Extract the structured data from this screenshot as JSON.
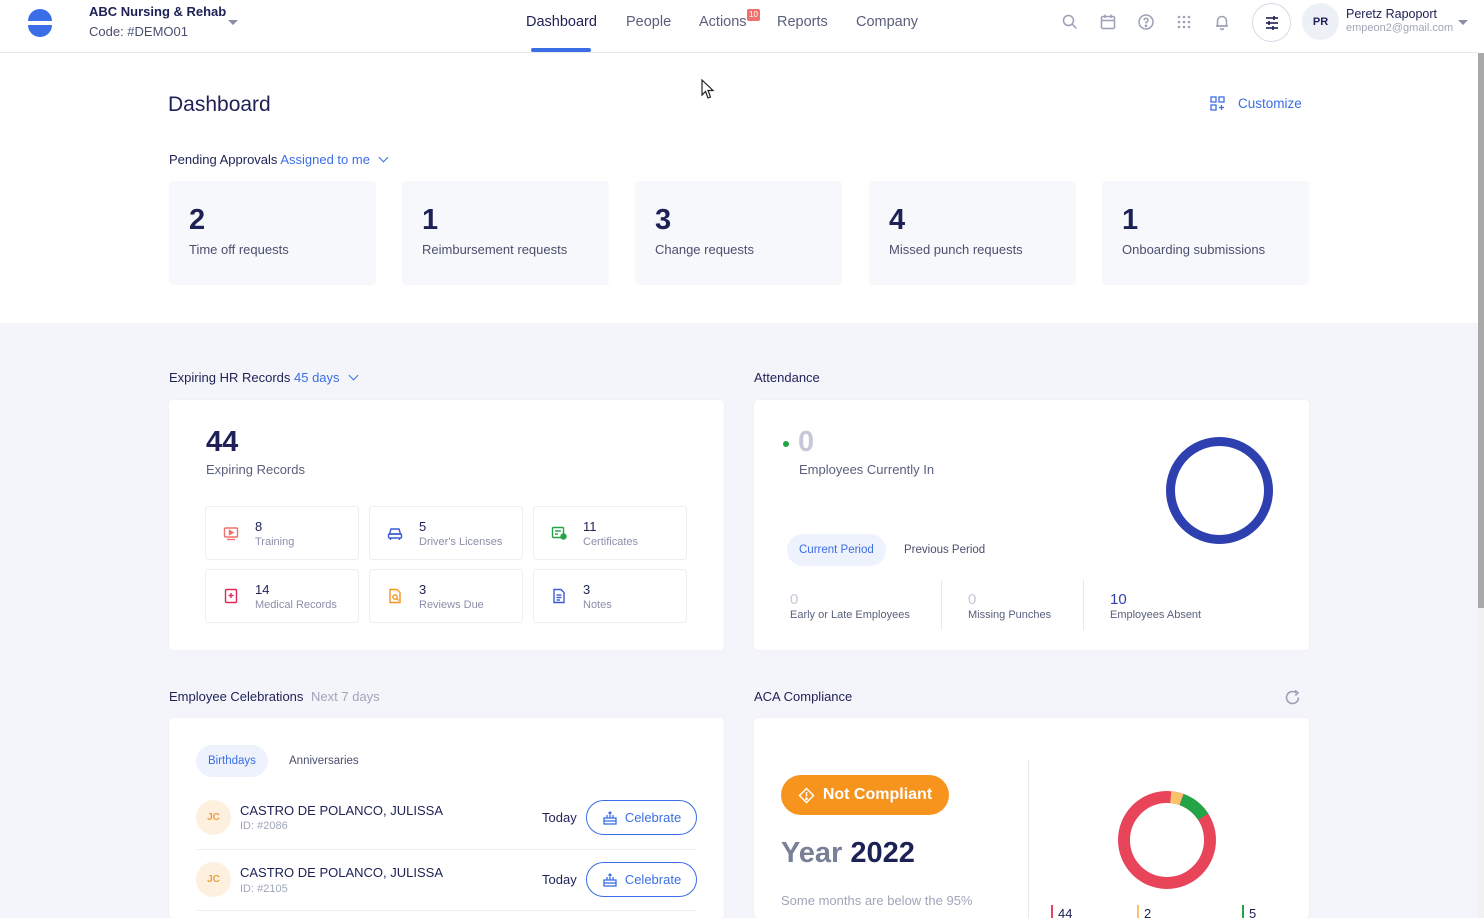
{
  "company": {
    "name": "ABC Nursing & Rehab",
    "code": "Code: #DEMO01"
  },
  "nav": {
    "items": [
      {
        "label": "Dashboard",
        "active": true
      },
      {
        "label": "People"
      },
      {
        "label": "Actions",
        "badge": "10"
      },
      {
        "label": "Reports"
      },
      {
        "label": "Company"
      }
    ]
  },
  "header_icons": [
    "search-icon",
    "calendar-icon",
    "help-icon",
    "apps-grid-icon",
    "bell-icon",
    "filter-sliders-icon"
  ],
  "user": {
    "initials": "PR",
    "name": "Peretz Rapoport",
    "email": "empeon2@gmail.com"
  },
  "page": {
    "title": "Dashboard",
    "customize_label": "Customize"
  },
  "pending_approvals": {
    "label": "Pending Approvals",
    "filter": "Assigned to me",
    "cards": [
      {
        "count": "2",
        "label": "Time off requests"
      },
      {
        "count": "1",
        "label": "Reimbursement requests"
      },
      {
        "count": "3",
        "label": "Change requests"
      },
      {
        "count": "4",
        "label": "Missed punch requests"
      },
      {
        "count": "1",
        "label": "Onboarding submissions"
      }
    ]
  },
  "expiring": {
    "label": "Expiring HR Records",
    "filter": "45 days",
    "total": "44",
    "total_label": "Expiring Records",
    "tiles": [
      {
        "count": "8",
        "label": "Training",
        "icon": "training-icon",
        "color": "#f0706e"
      },
      {
        "count": "5",
        "label": "Driver's Licenses",
        "icon": "car-icon",
        "color": "#3b5bd6"
      },
      {
        "count": "11",
        "label": "Certificates",
        "icon": "certificate-icon",
        "color": "#22a447"
      },
      {
        "count": "14",
        "label": "Medical Records",
        "icon": "medical-icon",
        "color": "#d92a5a"
      },
      {
        "count": "3",
        "label": "Reviews Due",
        "icon": "review-icon",
        "color": "#f7941d"
      },
      {
        "count": "3",
        "label": "Notes",
        "icon": "notes-icon",
        "color": "#3b5bd6"
      }
    ]
  },
  "attendance": {
    "label": "Attendance",
    "currently_in": "0",
    "currently_in_label": "Employees Currently In",
    "periods": [
      "Current Period",
      "Previous Period"
    ],
    "stats": [
      {
        "value": "0",
        "label": "Early or Late Employees"
      },
      {
        "value": "0",
        "label": "Missing Punches"
      },
      {
        "value": "10",
        "label": "Employees Absent"
      }
    ],
    "donut_color": "#2e3fb0"
  },
  "celebrations": {
    "label": "Employee Celebrations",
    "range": "Next 7 days",
    "tabs": [
      "Birthdays",
      "Anniversaries"
    ],
    "people": [
      {
        "initials": "JC",
        "name": "CASTRO DE POLANCO, JULISSA",
        "id": "ID: #2086",
        "when": "Today",
        "action": "Celebrate"
      },
      {
        "initials": "JC",
        "name": "CASTRO DE POLANCO, JULISSA",
        "id": "ID: #2105",
        "when": "Today",
        "action": "Celebrate"
      }
    ]
  },
  "aca": {
    "label": "ACA Compliance",
    "status": "Not Compliant",
    "year_label": "Year",
    "year": "2022",
    "note": "Some months are below the 95%",
    "legend": [
      {
        "value": "44",
        "color": "#e8445a"
      },
      {
        "value": "2",
        "color": "#f7c26b"
      },
      {
        "value": "5",
        "color": "#22a447"
      }
    ]
  }
}
